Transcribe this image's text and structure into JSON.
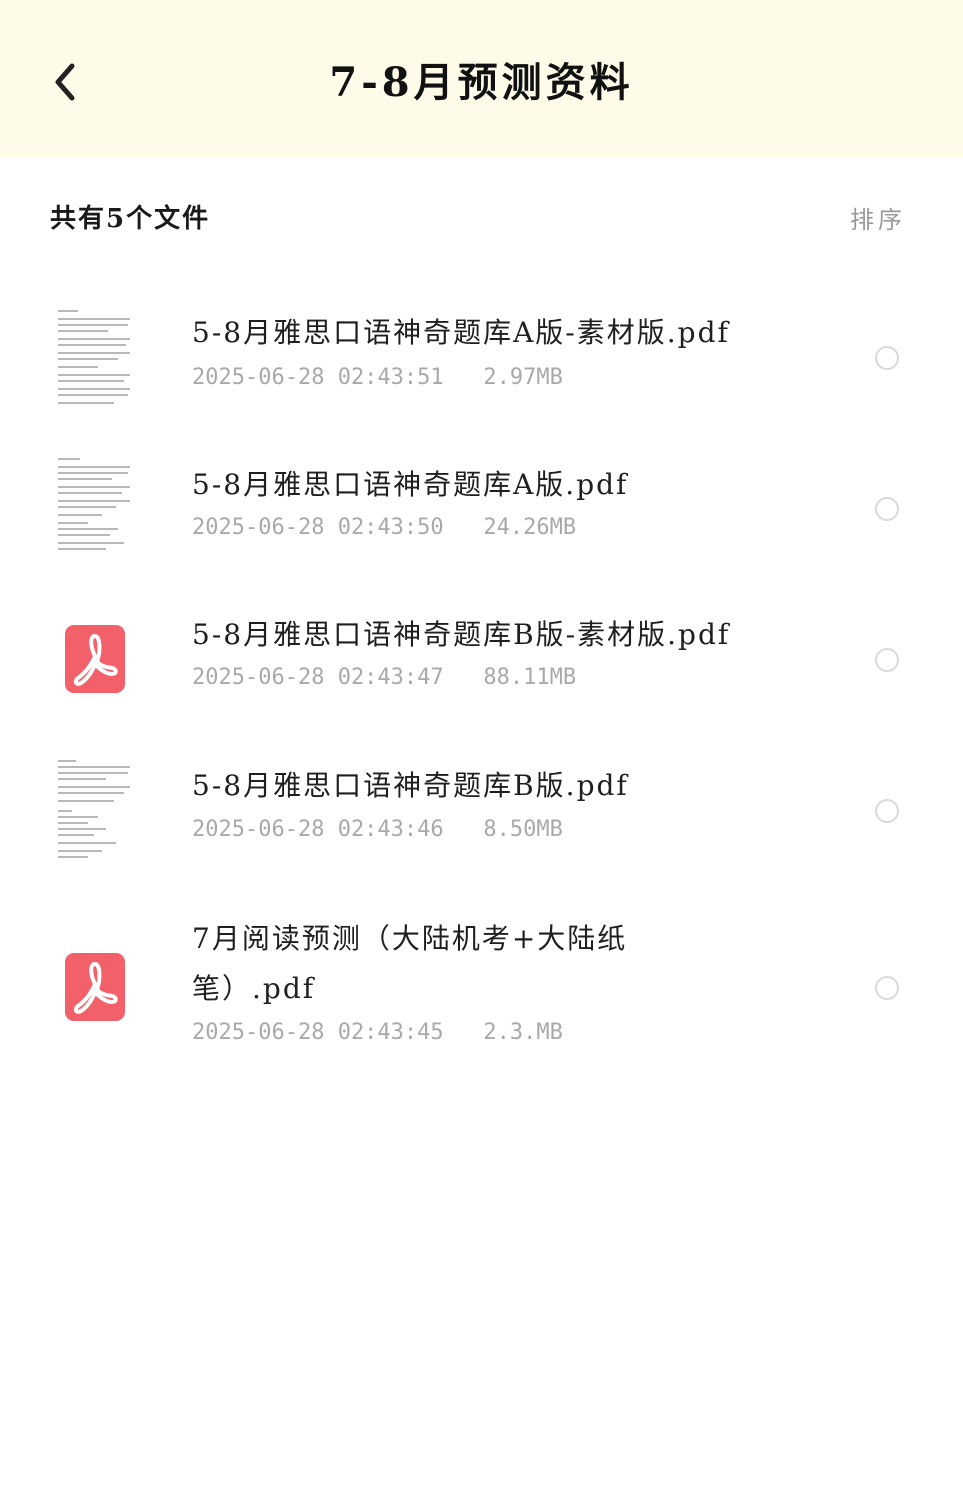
{
  "header": {
    "title": "7-8月预测资料",
    "back_icon": "chevron-left-icon"
  },
  "summary": {
    "file_count": "共有5个文件",
    "sort_label": "排序"
  },
  "files": [
    {
      "name": "5-8月雅思口语神奇题库A版-素材版.pdf",
      "date": "2025-06-28 02:43:51",
      "size": "2.97MB",
      "thumb": "document-thumbnail"
    },
    {
      "name": "5-8月雅思口语神奇题库A版.pdf",
      "date": "2025-06-28 02:43:50",
      "size": "24.26MB",
      "thumb": "document-thumbnail"
    },
    {
      "name": "5-8月雅思口语神奇题库B版-素材版.pdf",
      "date": "2025-06-28 02:43:47",
      "size": "88.11MB",
      "thumb": "pdf-icon"
    },
    {
      "name": "5-8月雅思口语神奇题库B版.pdf",
      "date": "2025-06-28 02:43:46",
      "size": "8.50MB",
      "thumb": "document-thumbnail"
    },
    {
      "name": "7月阅读预测（大陆机考+大陆纸笔）.pdf",
      "date": "2025-06-28 02:43:45",
      "size": "2.3.MB",
      "thumb": "pdf-icon"
    }
  ],
  "colors": {
    "header_bg": "#fefce9",
    "pdf_red": "#f2606a",
    "meta_gray": "#a9a9a9"
  }
}
